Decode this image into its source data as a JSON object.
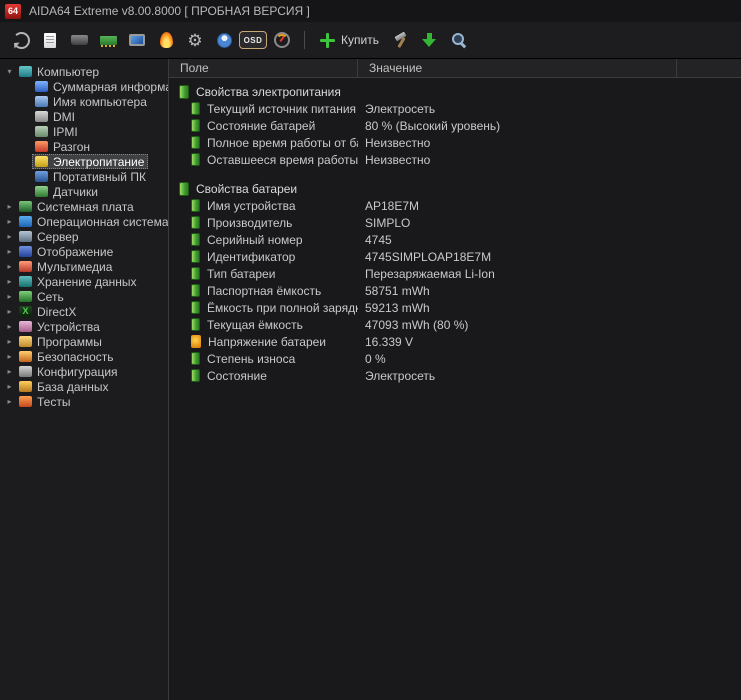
{
  "titlebar": {
    "logo_text": "64",
    "title": "AIDA64 Extreme v8.00.8000  [ ПРОБНАЯ ВЕРСИЯ ]"
  },
  "toolbar": {
    "items": [
      {
        "name": "refresh",
        "type": "icon"
      },
      {
        "name": "report",
        "type": "icon"
      },
      {
        "name": "chassis",
        "type": "icon"
      },
      {
        "name": "memory",
        "type": "icon"
      },
      {
        "name": "monitor",
        "type": "icon"
      },
      {
        "name": "fire",
        "type": "icon"
      },
      {
        "name": "services",
        "type": "icon"
      },
      {
        "name": "user",
        "type": "icon"
      },
      {
        "name": "osd",
        "type": "icon",
        "text": "OSD"
      },
      {
        "name": "gauge",
        "type": "icon"
      },
      {
        "name": "separator",
        "type": "separator"
      },
      {
        "name": "buy",
        "type": "button",
        "label": "Купить"
      },
      {
        "name": "hammer",
        "type": "icon"
      },
      {
        "name": "download",
        "type": "icon"
      },
      {
        "name": "search",
        "type": "icon"
      }
    ]
  },
  "sidebar": {
    "items": [
      {
        "id": "computer",
        "label": "Компьютер",
        "depth": 0,
        "expanded": true,
        "icon": "computer"
      },
      {
        "id": "summary",
        "label": "Суммарная информация",
        "depth": 1,
        "icon": "summary"
      },
      {
        "id": "computer-name",
        "label": "Имя компьютера",
        "depth": 1,
        "icon": "compname"
      },
      {
        "id": "dmi",
        "label": "DMI",
        "depth": 1,
        "icon": "dmi"
      },
      {
        "id": "ipmi",
        "label": "IPMI",
        "depth": 1,
        "icon": "ipmi"
      },
      {
        "id": "overclock",
        "label": "Разгон",
        "depth": 1,
        "icon": "overclock"
      },
      {
        "id": "power",
        "label": "Электропитание",
        "depth": 1,
        "icon": "power",
        "selected": true
      },
      {
        "id": "mobile-pc",
        "label": "Портативный ПК",
        "depth": 1,
        "icon": "laptop"
      },
      {
        "id": "sensors",
        "label": "Датчики",
        "depth": 1,
        "icon": "sensors"
      },
      {
        "id": "motherboard",
        "label": "Системная плата",
        "depth": 0,
        "expanded": false,
        "icon": "motherboard"
      },
      {
        "id": "os",
        "label": "Операционная система",
        "depth": 0,
        "expanded": false,
        "icon": "os"
      },
      {
        "id": "server",
        "label": "Сервер",
        "depth": 0,
        "expanded": false,
        "icon": "server"
      },
      {
        "id": "display",
        "label": "Отображение",
        "depth": 0,
        "expanded": false,
        "icon": "display"
      },
      {
        "id": "multimedia",
        "label": "Мультимедиа",
        "depth": 0,
        "expanded": false,
        "icon": "multimedia"
      },
      {
        "id": "storage",
        "label": "Хранение данных",
        "depth": 0,
        "expanded": false,
        "icon": "storage"
      },
      {
        "id": "network",
        "label": "Сеть",
        "depth": 0,
        "expanded": false,
        "icon": "network"
      },
      {
        "id": "directx",
        "label": "DirectX",
        "depth": 0,
        "expanded": false,
        "icon": "directx"
      },
      {
        "id": "devices",
        "label": "Устройства",
        "depth": 0,
        "expanded": false,
        "icon": "devices"
      },
      {
        "id": "programs",
        "label": "Программы",
        "depth": 0,
        "expanded": false,
        "icon": "programs"
      },
      {
        "id": "security",
        "label": "Безопасность",
        "depth": 0,
        "expanded": false,
        "icon": "security"
      },
      {
        "id": "config",
        "label": "Конфигурация",
        "depth": 0,
        "expanded": false,
        "icon": "config"
      },
      {
        "id": "database",
        "label": "База данных",
        "depth": 0,
        "expanded": false,
        "icon": "database"
      },
      {
        "id": "tests",
        "label": "Тесты",
        "depth": 0,
        "expanded": false,
        "icon": "tests"
      }
    ]
  },
  "main": {
    "columns": {
      "field": "Поле",
      "value": "Значение"
    },
    "sections": [
      {
        "title": "Свойства электропитания",
        "icon": "battery",
        "rows": [
          {
            "icon": "battery",
            "field": "Текущий источник питания",
            "value": "Электросеть"
          },
          {
            "icon": "battery",
            "field": "Состояние батарей",
            "value": "80 % (Высокий уровень)"
          },
          {
            "icon": "battery",
            "field": "Полное время работы от бата...",
            "value": "Неизвестно"
          },
          {
            "icon": "battery",
            "field": "Оставшееся время работы от ...",
            "value": "Неизвестно"
          }
        ]
      },
      {
        "title": "Свойства батареи",
        "icon": "battery",
        "rows": [
          {
            "icon": "battery",
            "field": "Имя устройства",
            "value": "AP18E7M"
          },
          {
            "icon": "battery",
            "field": "Производитель",
            "value": "SIMPLO"
          },
          {
            "icon": "battery",
            "field": "Серийный номер",
            "value": "4745"
          },
          {
            "icon": "battery",
            "field": "Идентификатор",
            "value": "4745SIMPLOAP18E7M"
          },
          {
            "icon": "battery",
            "field": "Тип батареи",
            "value": "Перезаряжаемая Li-Ion"
          },
          {
            "icon": "battery",
            "field": "Паспортная ёмкость",
            "value": "58751 mWh"
          },
          {
            "icon": "battery",
            "field": "Ёмкость при полной зарядке",
            "value": "59213 mWh"
          },
          {
            "icon": "battery",
            "field": "Текущая ёмкость",
            "value": "47093 mWh  (80 %)"
          },
          {
            "icon": "voltage",
            "field": "Напряжение батареи",
            "value": "16.339 V"
          },
          {
            "icon": "battery",
            "field": "Степень износа",
            "value": "0 %"
          },
          {
            "icon": "battery",
            "field": "Состояние",
            "value": "Электросеть"
          }
        ]
      }
    ]
  },
  "colors": {
    "battery_green": "#3f9b2f",
    "buy_green": "#3fc43f",
    "selection_bg": "#3e4042",
    "background": "#1a1a1c",
    "logo_red": "#c62a21"
  }
}
